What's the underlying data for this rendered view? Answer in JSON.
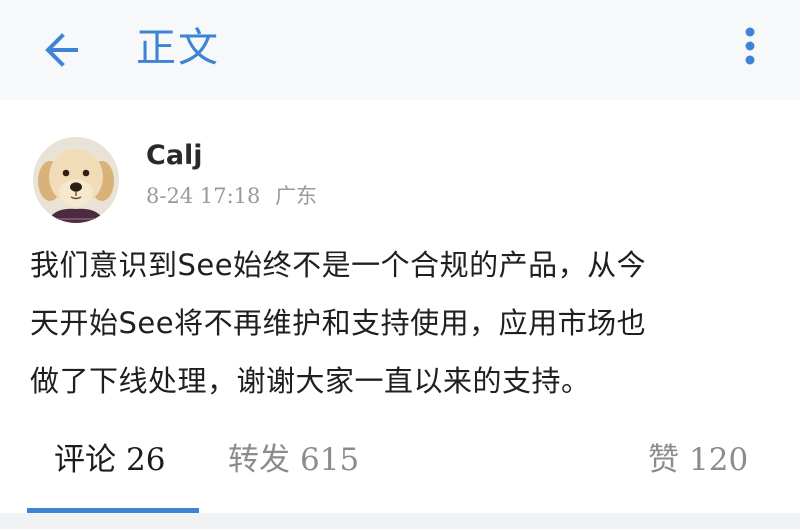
{
  "header": {
    "title": "正文",
    "back_icon": "back-arrow-icon",
    "more_icon": "more-vertical-icon",
    "accent_color": "#3f83d5"
  },
  "post": {
    "author": "Calj",
    "date": "8-24 17:18",
    "location": "广东",
    "content_lines": [
      "我们意识到See始终不是一个合规的产品，从今",
      "天开始See将不再维护和支持使用，应用市场也",
      "做了下线处理，谢谢大家一直以来的支持。"
    ]
  },
  "tabs": {
    "comments": {
      "label": "评论",
      "count": "26"
    },
    "reposts": {
      "label": "转发",
      "count": "615"
    },
    "likes": {
      "label": "赞",
      "count": "120"
    },
    "active": "comments"
  }
}
